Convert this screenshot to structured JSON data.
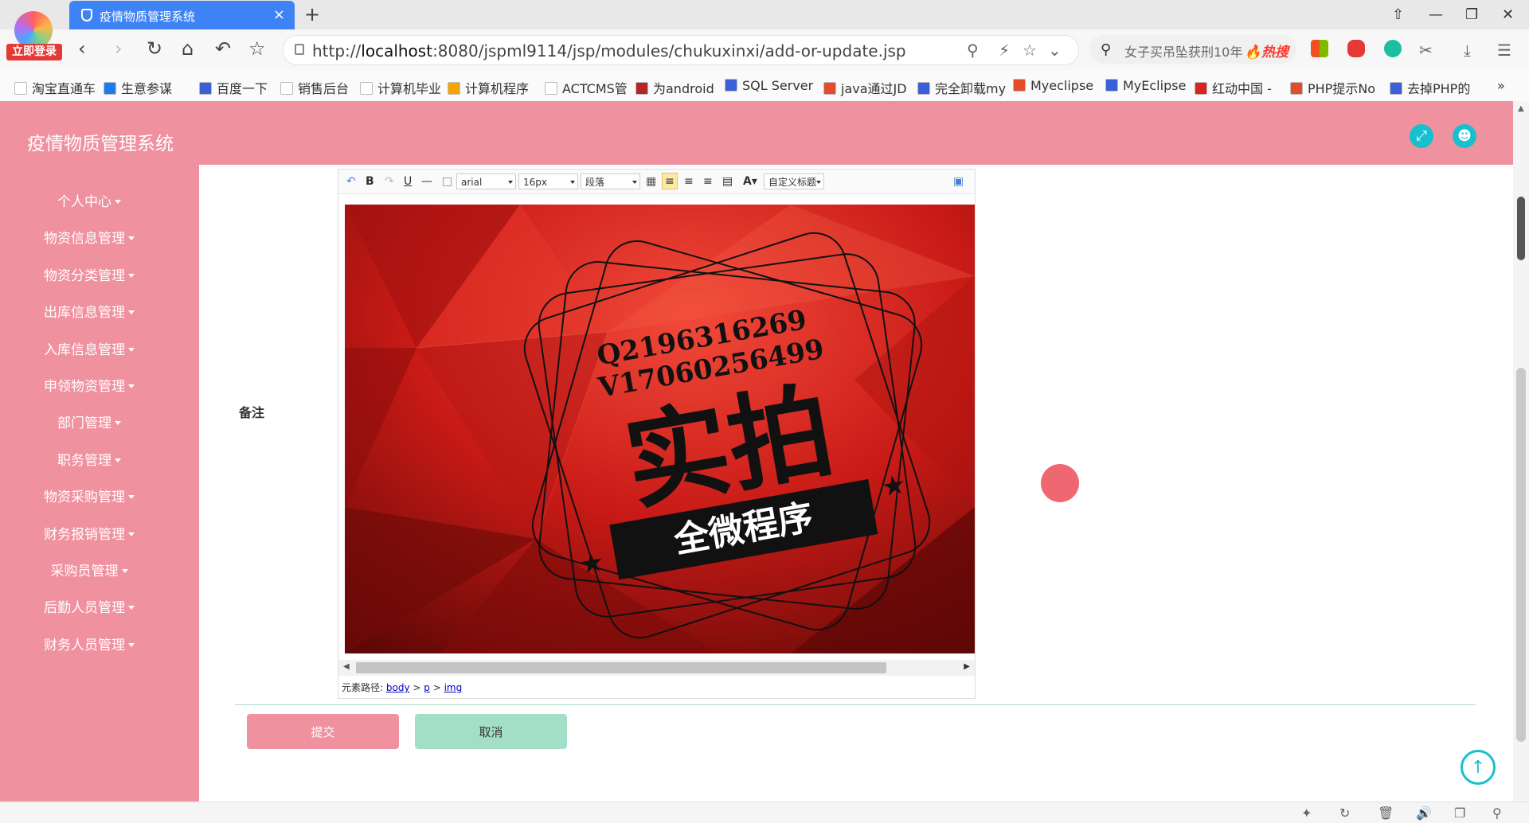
{
  "browser": {
    "login_badge": "立即登录",
    "tab_title": "疫情物质管理系统",
    "tab_close": "×",
    "new_tab": "+",
    "url_prefix": "http://",
    "url_host": "localhost",
    "url_rest": ":8080/jspml9114/jsp/modules/chukuxinxi/add-or-update.jsp",
    "search_text": "女子买吊坠获刑10年",
    "search_hot": "🔥热搜",
    "controls": {
      "minimize": "—",
      "restore": "❐",
      "close": "✕",
      "pin": "⇧"
    },
    "bookmarks": [
      {
        "label": "淘宝直通车",
        "color": "#ffffff"
      },
      {
        "label": "生意参谋",
        "color": "#1e7af0"
      },
      {
        "label": "百度一下",
        "color": "#3a5fd8"
      },
      {
        "label": "销售后台",
        "color": "#ffffff"
      },
      {
        "label": "计算机毕业",
        "color": "#ffffff"
      },
      {
        "label": "计算机程序",
        "color": "#f7a400"
      },
      {
        "label": "ACTCMS管",
        "color": "#ffffff"
      },
      {
        "label": "为android",
        "color": "#b72626"
      },
      {
        "label": "SQL Server",
        "color": "#3a5fd8"
      },
      {
        "label": "java通过JD",
        "color": "#e34b2d"
      },
      {
        "label": "完全卸载my",
        "color": "#3a5fd8"
      },
      {
        "label": "Myeclipse",
        "color": "#e34b2d"
      },
      {
        "label": "MyEclipse",
        "color": "#3a5fd8"
      },
      {
        "label": "红动中国 -",
        "color": "#d8231f"
      },
      {
        "label": "PHP提示No",
        "color": "#e34b2d"
      },
      {
        "label": "去掉PHP的",
        "color": "#3a5fd8"
      }
    ],
    "bookmarks_more": "»"
  },
  "app": {
    "title": "疫情物质管理系统",
    "accent": "#f0919f",
    "teal": "#17c0ce"
  },
  "sidebar": {
    "items": [
      {
        "label": "个人中心"
      },
      {
        "label": "物资信息管理"
      },
      {
        "label": "物资分类管理"
      },
      {
        "label": "出库信息管理"
      },
      {
        "label": "入库信息管理"
      },
      {
        "label": "申领物资管理"
      },
      {
        "label": "部门管理"
      },
      {
        "label": "职务管理"
      },
      {
        "label": "物资采购管理"
      },
      {
        "label": "财务报销管理"
      },
      {
        "label": "采购员管理"
      },
      {
        "label": "后勤人员管理"
      },
      {
        "label": "财务人员管理"
      }
    ]
  },
  "form": {
    "remark_label": "备注",
    "editor": {
      "font_family": "arial",
      "font_size": "16px",
      "paragraph": "段落",
      "custom_title": "自定义标题",
      "path_label": "元素路径:",
      "path": [
        "body",
        "p",
        "img"
      ]
    },
    "image": {
      "line1": "Q2196316269",
      "line2": "V17060256499",
      "big": "实拍",
      "banner": "全微程序"
    },
    "submit_label": "提交",
    "cancel_label": "取消"
  }
}
